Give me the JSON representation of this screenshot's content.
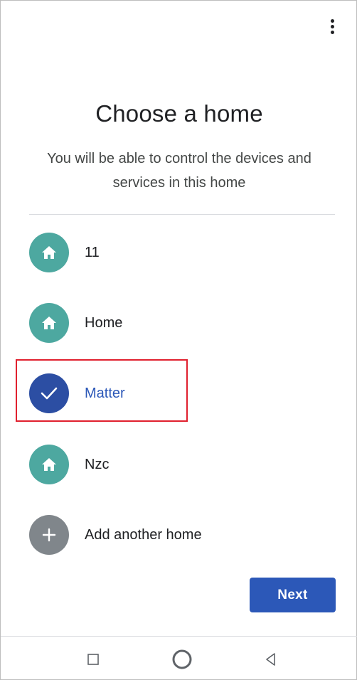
{
  "header": {
    "menu_icon": "more-vert-icon"
  },
  "main": {
    "title": "Choose a home",
    "subtitle": "You will be able to control the devices and services in this home"
  },
  "homes": [
    {
      "label": "11",
      "icon": "home-icon",
      "selected": false
    },
    {
      "label": "Home",
      "icon": "home-icon",
      "selected": false
    },
    {
      "label": "Matter",
      "icon": "check-icon",
      "selected": true
    },
    {
      "label": "Nzc",
      "icon": "home-icon",
      "selected": false
    }
  ],
  "add_home": {
    "label": "Add another home",
    "icon": "plus-icon"
  },
  "actions": {
    "next_label": "Next"
  },
  "system_nav": {
    "recents_icon": "square-icon",
    "home_icon": "circle-icon",
    "back_icon": "triangle-back-icon"
  },
  "colors": {
    "accent": "#2c58b8",
    "teal_avatar": "#4da8a0",
    "selected_avatar": "#2c4ea3",
    "gray_avatar": "#80868b",
    "highlight_border": "#e0202e"
  }
}
